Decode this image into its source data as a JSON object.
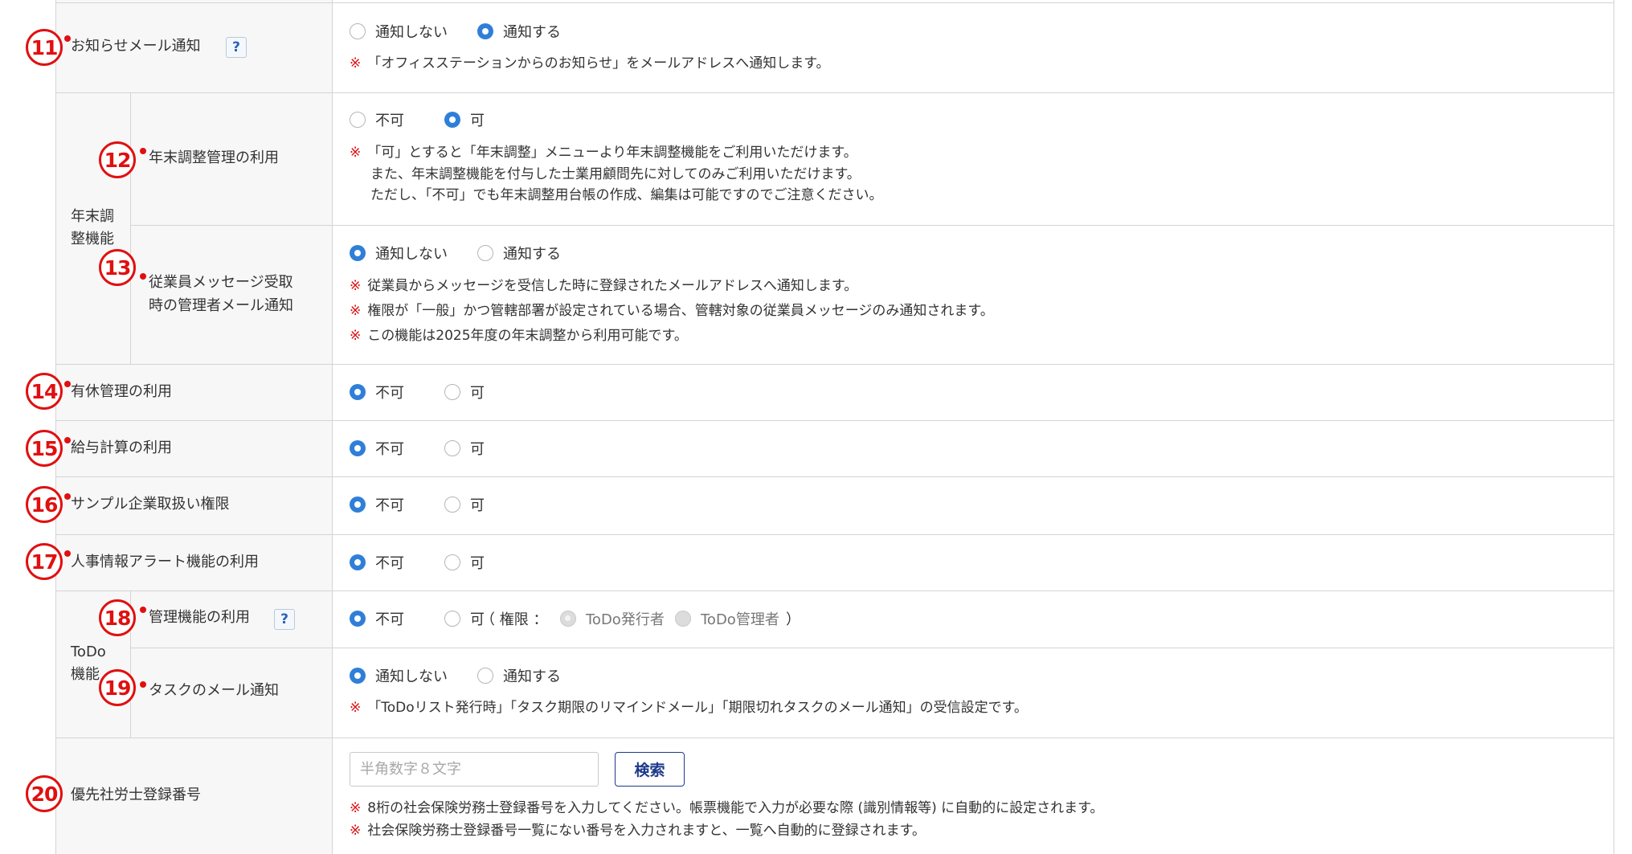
{
  "rows": {
    "r11": {
      "num": "11",
      "label": "お知らせメール通知",
      "help": "?",
      "options": [
        "通知しない",
        "通知する"
      ],
      "selected": 1,
      "notes": [
        "「オフィスステーションからのお知らせ」をメールアドレスへ通知します。"
      ]
    },
    "group_nenmatsu": {
      "label_line1": "年末調",
      "label_line2": "整機能"
    },
    "r12": {
      "num": "12",
      "label": "年末調整管理の利用",
      "options": [
        "不可",
        "可"
      ],
      "selected": 1,
      "notes": [
        "「可」とすると「年末調整」メニューより年末調整機能をご利用いただけます。",
        "また、年末調整機能を付与した士業用顧問先に対してのみご利用いただけます。",
        "ただし、「不可」でも年末調整用台帳の作成、編集は可能ですのでご注意ください。"
      ]
    },
    "r13": {
      "num": "13",
      "label_line1": "従業員メッセージ受取",
      "label_line2": "時の管理者メール通知",
      "options": [
        "通知しない",
        "通知する"
      ],
      "selected": 0,
      "notes": [
        "従業員からメッセージを受信した時に登録されたメールアドレスへ通知します。",
        "権限が「一般」かつ管轄部署が設定されている場合、管轄対象の従業員メッセージのみ通知されます。",
        "この機能は2025年度の年末調整から利用可能です。"
      ]
    },
    "r14": {
      "num": "14",
      "label": "有休管理の利用",
      "options": [
        "不可",
        "可"
      ],
      "selected": 0
    },
    "r15": {
      "num": "15",
      "label": "給与計算の利用",
      "options": [
        "不可",
        "可"
      ],
      "selected": 0
    },
    "r16": {
      "num": "16",
      "label": "サンプル企業取扱い権限",
      "options": [
        "不可",
        "可"
      ],
      "selected": 0
    },
    "r17": {
      "num": "17",
      "label": "人事情報アラート機能の利用",
      "options": [
        "不可",
        "可"
      ],
      "selected": 0
    },
    "group_todo": {
      "label_line1": "ToDo",
      "label_line2": "機能"
    },
    "r18": {
      "num": "18",
      "label": "管理機能の利用",
      "help": "?",
      "options": [
        "不可",
        "可"
      ],
      "selected": 0,
      "perm_prefix": "（ 権限 ：",
      "perm_options": [
        "ToDo発行者",
        "ToDo管理者"
      ],
      "perm_suffix": "）"
    },
    "r19": {
      "num": "19",
      "label": "タスクのメール通知",
      "options": [
        "通知しない",
        "通知する"
      ],
      "selected": 0,
      "notes": [
        "「ToDoリスト発行時」「タスク期限のリマインドメール」「期限切れタスクのメール通知」の受信設定です。"
      ]
    },
    "r20": {
      "num": "20",
      "label": "優先社労士登録番号",
      "input_placeholder": "半角数字８文字",
      "input_value": "",
      "search_label": "検索",
      "notes": [
        "8桁の社会保険労務士登録番号を入力してください。帳票機能で入力が必要な際 (識別情報等) に自動的に設定されます。",
        "社会保険労務士登録番号一覧にない番号を入力されますと、一覧へ自動的に登録されます。"
      ]
    }
  },
  "note_mark": "※",
  "colors": {
    "accent": "#2f7fd8",
    "annotation": "#e01010",
    "border": "#d4d4d4",
    "label_bg": "#f7f7f7",
    "button_text": "#1e3a8a"
  }
}
